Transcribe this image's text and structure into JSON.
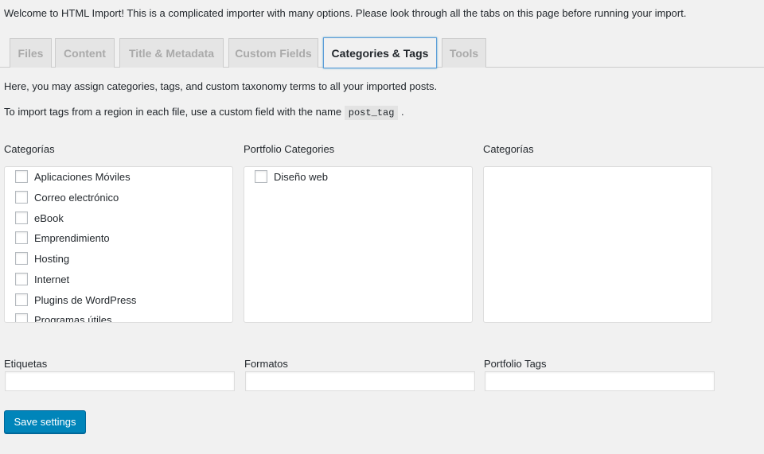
{
  "intro": "Welcome to HTML Import! This is a complicated importer with many options. Please look through all the tabs on this page before running your import.",
  "tabs": [
    "Files",
    "Content",
    "Title & Metadata",
    "Custom Fields",
    "Categories & Tags",
    "Tools"
  ],
  "active_tab": "Categories & Tags",
  "desc": "Here, you may assign categories, tags, and custom taxonomy terms to all your imported posts.",
  "tags_note": {
    "before": "To import tags from a region in each file, use a custom field with the name",
    "code": "post_tag",
    "after": "."
  },
  "taxonomies": [
    {
      "label": "Categorías",
      "items": [
        "Aplicaciones Móviles",
        "Correo electrónico",
        "eBook",
        "Emprendimiento",
        "Hosting",
        "Internet",
        "Plugins de WordPress",
        "Programas útiles"
      ]
    },
    {
      "label": "Portfolio Categories",
      "items": [
        "Diseño web"
      ]
    },
    {
      "label": "Categorías",
      "items": []
    }
  ],
  "fields": [
    {
      "label": "Etiquetas",
      "value": ""
    },
    {
      "label": "Formatos",
      "value": ""
    },
    {
      "label": "Portfolio Tags",
      "value": ""
    }
  ],
  "save_label": "Save settings",
  "colors": {
    "accent": "#0085ba",
    "background": "#f1f1f1"
  }
}
